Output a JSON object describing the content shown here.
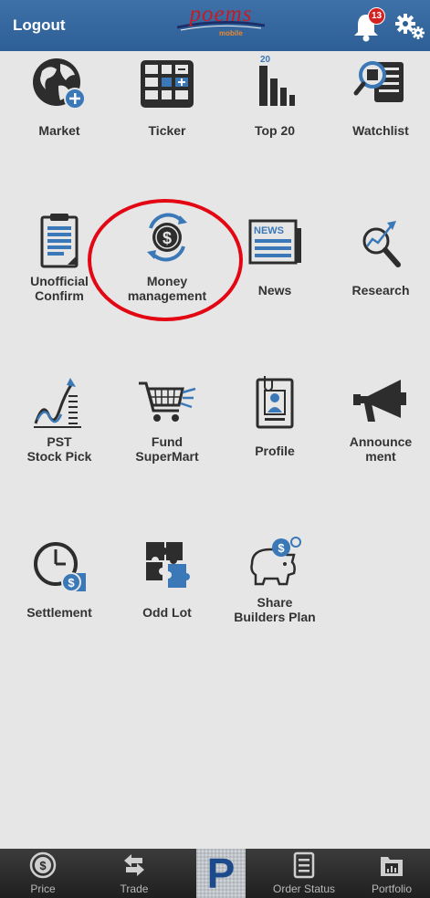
{
  "header": {
    "logout_label": "Logout",
    "logo_text": "poems",
    "logo_sub": "mobile",
    "notification_count": "13"
  },
  "tiles": [
    {
      "label": "Market",
      "icon": "globe-plus-icon"
    },
    {
      "label": "Ticker",
      "icon": "ticker-board-icon"
    },
    {
      "label": "Top 20",
      "icon": "top20-bars-icon",
      "icon_text": "20"
    },
    {
      "label": "Watchlist",
      "icon": "magnifier-list-icon"
    },
    {
      "label": "Unofficial\nConfirm",
      "icon": "clipboard-icon"
    },
    {
      "label": "Money\nmanagement",
      "icon": "money-exchange-icon"
    },
    {
      "label": "News",
      "icon": "newspaper-icon",
      "icon_text": "NEWS"
    },
    {
      "label": "Research",
      "icon": "research-magnifier-icon"
    },
    {
      "label": "PST\nStock Pick",
      "icon": "stock-chart-icon"
    },
    {
      "label": "Fund\nSuperMart",
      "icon": "shopping-cart-icon"
    },
    {
      "label": "Profile",
      "icon": "profile-card-icon"
    },
    {
      "label": "Announce\nment",
      "icon": "megaphone-icon"
    },
    {
      "label": "Settlement",
      "icon": "clock-coin-icon"
    },
    {
      "label": "Odd Lot",
      "icon": "puzzle-icon"
    },
    {
      "label": "Share\nBuilders Plan",
      "icon": "piggy-bank-icon"
    }
  ],
  "tabbar": {
    "items": [
      {
        "label": "Price",
        "icon": "dollar-coin-icon"
      },
      {
        "label": "Trade",
        "icon": "trade-arrows-icon"
      },
      {
        "label": "",
        "icon": "poems-p-logo-icon",
        "text": "P"
      },
      {
        "label": "Order Status",
        "icon": "order-list-icon"
      },
      {
        "label": "Portfolio",
        "icon": "portfolio-folder-icon"
      }
    ]
  },
  "colors": {
    "header_bg": "#2e5f97",
    "accent_blue": "#3a78b8",
    "icon_dark": "#2d2d2d",
    "highlight_circle": "#e30613",
    "badge_red": "#d42121"
  }
}
